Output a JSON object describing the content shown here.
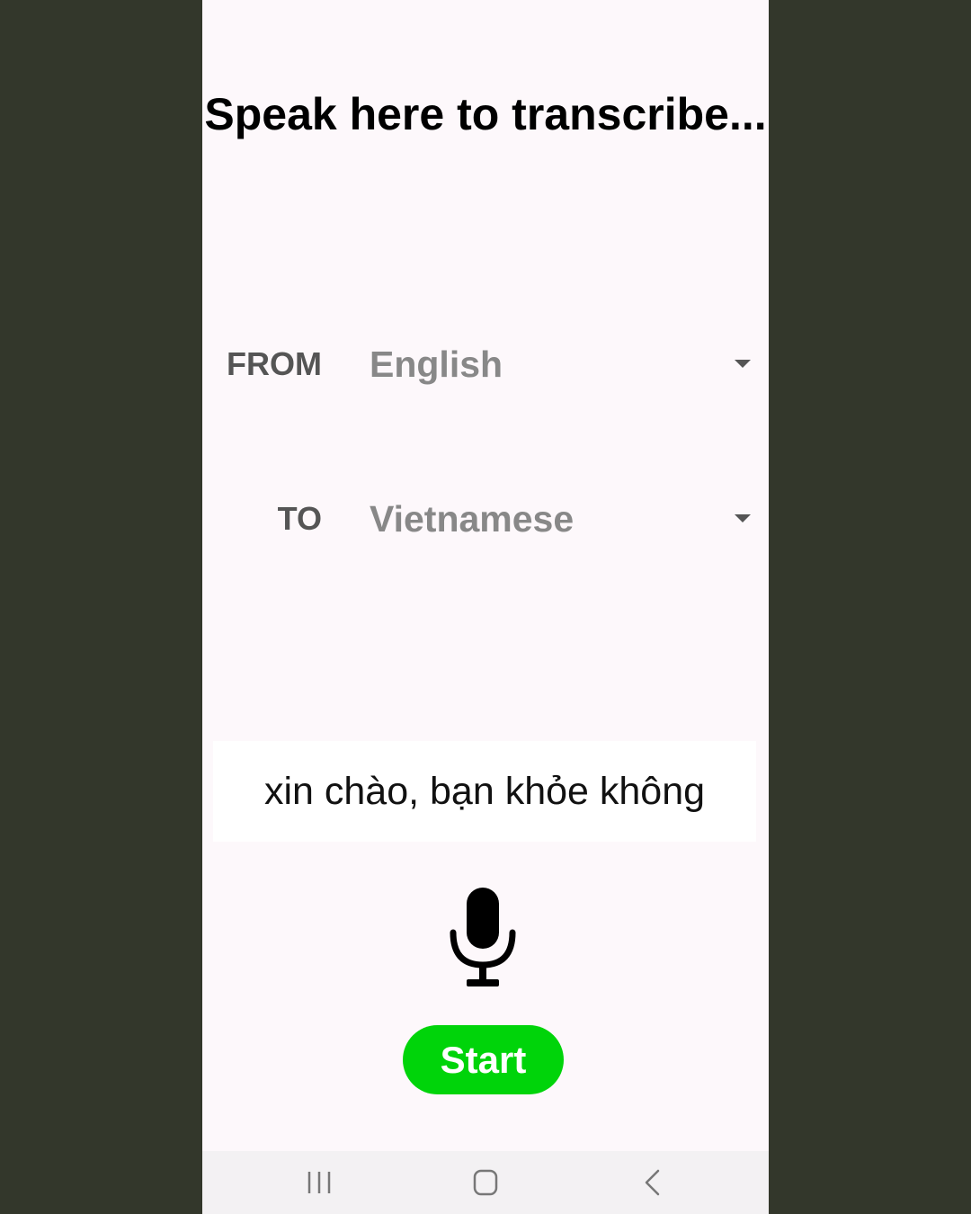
{
  "screen": {
    "title": "Speak here to transcribe..."
  },
  "from": {
    "label": "FROM",
    "selected": "English"
  },
  "to": {
    "label": "TO",
    "selected": "Vietnamese"
  },
  "result": {
    "text": "xin chào, bạn khỏe không"
  },
  "mic": {
    "icon": "microphone-icon"
  },
  "start_button": {
    "label": "Start",
    "color": "#00d40a"
  },
  "navbar": {
    "recent_icon": "recent-apps-icon",
    "home_icon": "home-icon",
    "back_icon": "back-icon"
  },
  "colors": {
    "outer_background": "#33372b",
    "screen_background": "#fdf8fb",
    "accent": "#00d40a"
  }
}
